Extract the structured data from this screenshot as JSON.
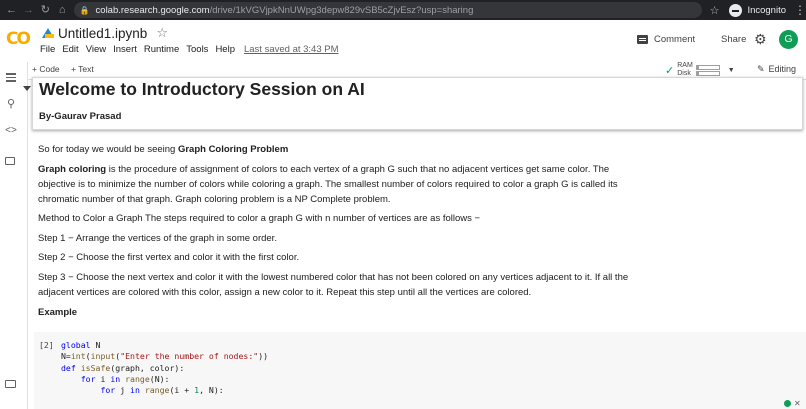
{
  "browser": {
    "url_domain": "colab.research.google.com",
    "url_path": "/drive/1kVGVjpkNnUWpg3depw829vSB5cZjvEsz?usp=sharing",
    "profile_label": "Incognito"
  },
  "app": {
    "logo_text": "CO",
    "notebook_title": "Untitled1.ipynb",
    "menu": [
      "File",
      "Edit",
      "View",
      "Insert",
      "Runtime",
      "Tools",
      "Help"
    ],
    "last_saved": "Last saved at 3:43 PM",
    "comment_label": "Comment",
    "share_label": "Share",
    "avatar_letter": "G"
  },
  "toolbar": {
    "add_code": "+ Code",
    "add_text": "+ Text",
    "ram_label": "RAM",
    "disk_label": "Disk",
    "ram_fraction": 0.12,
    "disk_fraction": 0.1,
    "editing_label": "Editing"
  },
  "notebook": {
    "heading": "Welcome to Introductory Session on AI",
    "byline": "By-Gaurav Prasad",
    "intro_prefix": "So for today we would be seeing ",
    "intro_bold": "Graph Coloring Problem",
    "para1_bold": "Graph coloring",
    "para1_line1": " is the procedure of assignment of colors to each vertex of a graph G such that no adjacent vertices get same color. The",
    "para1_line2": "objective is to minimize the number of colors while coloring a graph. The smallest number of colors required to color a graph G is called its",
    "para1_line3": "chromatic number of that graph. Graph coloring problem is a NP Complete problem.",
    "method": "Method to Color a Graph The steps required to color a graph G with n number of vertices are as follows −",
    "step1": "Step 1 − Arrange the vertices of the graph in some order.",
    "step2": "Step 2 − Choose the first vertex and color it with the first color.",
    "step3_line1": "Step 3 − Choose the next vertex and color it with the lowest numbered color that has not been colored on any vertices adjacent to it. If all the",
    "step3_line2": "adjacent vertices are colored with this color, assign a new color to it. Repeat this step until all the vertices are colored.",
    "example_label": "Example"
  },
  "code_cell": {
    "exec_count": "[2]",
    "lines": [
      "global N",
      "N=int(input(\"Enter the number of nodes:\"))",
      "def isSafe(graph, color):",
      "    for i in range(N):",
      "        for j in range(i + 1, N):"
    ]
  },
  "colors": {
    "accent_green": "#0f9d58",
    "logo_orange": "#f9ab00",
    "chrome_bg": "#202124"
  }
}
